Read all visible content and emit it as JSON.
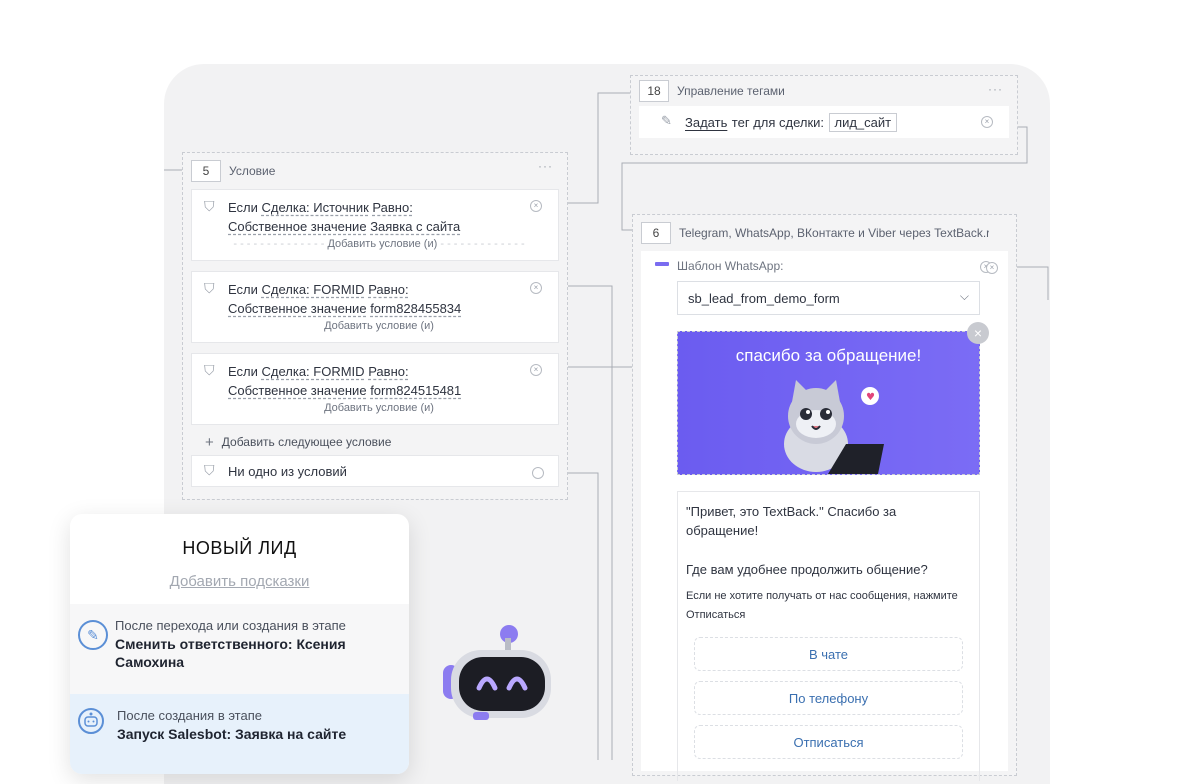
{
  "node18": {
    "num": "18",
    "title": "Управление тегами",
    "action": {
      "prefix": "Задать",
      "mid": "тег для сделки:",
      "tag": "лид_сайт"
    }
  },
  "node5": {
    "num": "5",
    "title": "Условие",
    "conditions": [
      {
        "if": "Если",
        "field": "Сделка: Источник",
        "op": "Равно:",
        "valtype": "Собственное значение",
        "value": "Заявка с сайта",
        "add": "Добавить условие (и)"
      },
      {
        "if": "Если",
        "field": "Сделка: FORMID",
        "op": "Равно:",
        "valtype": "Собственное значение",
        "value": "form828455834",
        "add": "Добавить условие (и)"
      },
      {
        "if": "Если",
        "field": "Сделка: FORMID",
        "op": "Равно:",
        "valtype": "Собственное значение",
        "value": "form824515481",
        "add": "Добавить условие (и)"
      }
    ],
    "add_next": "Добавить следующее условие",
    "none": "Ни одно из условий"
  },
  "node6": {
    "num": "6",
    "title": "Telegram, WhatsApp, ВКонтакте и Viber через TextBack.ru",
    "template_label": "Шаблон WhatsApp:",
    "template_value": "sb_lead_from_demo_form",
    "banner_text": "спасибо за обращение!",
    "msg1": "\"Привет, это TextBack.\" Спасибо за обращение!",
    "msg2": "Где вам удобнее продолжить общение?",
    "msg3": "Если не хотите получать от нас сообщения, нажмите Отписаться",
    "buttons": [
      "В чате",
      "По телефону",
      "Отписаться"
    ]
  },
  "lead": {
    "title": "НОВЫЙ ЛИД",
    "hint": "Добавить подсказки",
    "row1": {
      "t1": "После перехода или создания в этапе",
      "t2": "Сменить ответственного: Ксения Самохина"
    },
    "row2": {
      "t1": "После создания в этапе",
      "t2": "Запуск Salesbot: Заявка на сайте"
    }
  },
  "colors": {
    "accent": "#6b5cf0",
    "link": "#3a6fb0",
    "canvas": "#f2f2f3"
  }
}
